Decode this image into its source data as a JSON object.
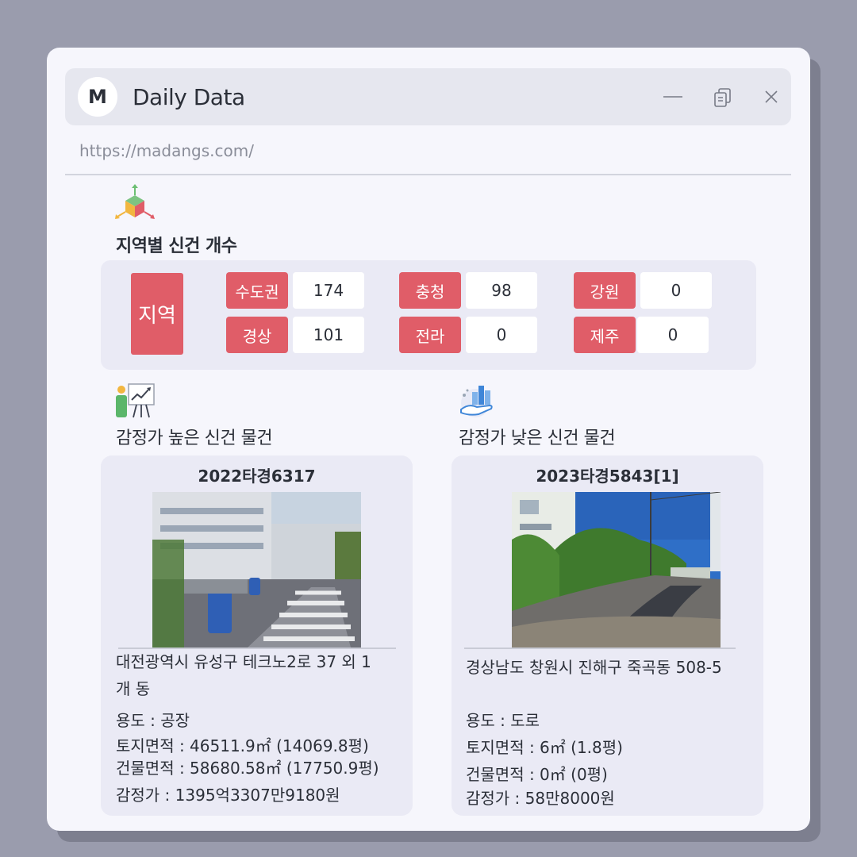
{
  "window": {
    "avatar_letter": "M",
    "title": "Daily Data",
    "url": "https://madangs.com/",
    "controls": {
      "minimize": "minimize-icon",
      "copy": "copy-icon",
      "close": "close-icon"
    }
  },
  "region_section": {
    "title": "지역별 신건 개수",
    "label": "지역",
    "regions": [
      {
        "name": "수도권",
        "count": "174"
      },
      {
        "name": "충청",
        "count": "98"
      },
      {
        "name": "강원",
        "count": "0"
      },
      {
        "name": "경상",
        "count": "101"
      },
      {
        "name": "전라",
        "count": "0"
      },
      {
        "name": "제주",
        "count": "0"
      }
    ]
  },
  "high_section": {
    "title": "감정가 높은 신건 물건",
    "case_id": "2022타경6317",
    "address_line1": "대전광역시 유성구 테크노2로 37 외 1",
    "address_line2": "개 동",
    "usage": "용도 : 공장",
    "land_area": "토지면적 : 46511.9㎡ (14069.8평)",
    "building_area": "건물면적 : 58680.58㎡ (17750.9평)",
    "appraisal": "감정가 : 1395억3307만9180원"
  },
  "low_section": {
    "title": "감정가 낮은 신건 물건",
    "case_id": "2023타경5843[1]",
    "address_line1": "경상남도 창원시 진해구 죽곡동 508-5",
    "usage": "용도 :  도로",
    "land_area": "토지면적 : 6㎡ (1.8평)",
    "building_area": "건물면적 : 0㎡ (0평)",
    "appraisal": "감정가 : 58만8000원"
  },
  "colors": {
    "accent": "#e05d68",
    "panel": "#eaeaf5",
    "window": "#f6f6fc",
    "backdrop": "#9a9cad"
  }
}
